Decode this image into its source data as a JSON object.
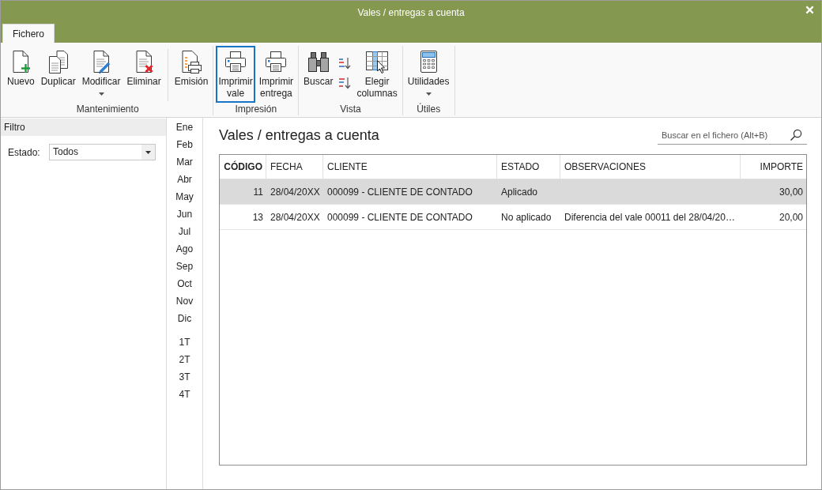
{
  "window": {
    "title": "Vales / entregas a cuenta"
  },
  "ribbon": {
    "tabs": [
      {
        "label": "Fichero",
        "selected": true
      }
    ],
    "groups": [
      {
        "label": "Mantenimiento",
        "items": [
          {
            "kind": "large",
            "label": "Nuevo",
            "selected": false,
            "dropdown": false
          },
          {
            "kind": "large",
            "label": "Duplicar",
            "selected": false,
            "dropdown": false
          },
          {
            "kind": "large",
            "label": "Modificar",
            "selected": false,
            "dropdown": true
          },
          {
            "kind": "large",
            "label": "Eliminar",
            "selected": false,
            "dropdown": false
          },
          {
            "kind": "separator"
          },
          {
            "kind": "large",
            "label": "Emisión",
            "selected": false,
            "dropdown": false
          }
        ]
      },
      {
        "label": "Impresión",
        "items": [
          {
            "kind": "large",
            "label": "Imprimir vale",
            "selected": true,
            "dropdown": false
          },
          {
            "kind": "large",
            "label": "Imprimir entrega",
            "selected": false,
            "dropdown": false
          }
        ]
      },
      {
        "label": "Vista",
        "items": [
          {
            "kind": "large",
            "label": "Buscar",
            "selected": false,
            "dropdown": false
          },
          {
            "kind": "small",
            "selected": false
          },
          {
            "kind": "small",
            "selected": false
          },
          {
            "kind": "large",
            "label": "Elegir columnas",
            "selected": false,
            "dropdown": false
          }
        ]
      },
      {
        "label": "Útiles",
        "items": [
          {
            "kind": "large",
            "label": "Utilidades",
            "selected": false,
            "dropdown": true
          }
        ]
      }
    ]
  },
  "filter": {
    "title": "Filtro",
    "fields": [
      {
        "label": "Estado:",
        "value": "Todos"
      }
    ]
  },
  "periods": {
    "months": [
      {
        "label": "Ene",
        "selected": false
      },
      {
        "label": "Feb",
        "selected": false
      },
      {
        "label": "Mar",
        "selected": false
      },
      {
        "label": "Abr",
        "selected": false
      },
      {
        "label": "May",
        "selected": false
      },
      {
        "label": "Jun",
        "selected": false
      },
      {
        "label": "Jul",
        "selected": false
      },
      {
        "label": "Ago",
        "selected": false
      },
      {
        "label": "Sep",
        "selected": false
      },
      {
        "label": "Oct",
        "selected": false
      },
      {
        "label": "Nov",
        "selected": false
      },
      {
        "label": "Dic",
        "selected": false
      }
    ],
    "quarters": [
      {
        "label": "1T",
        "selected": false
      },
      {
        "label": "2T",
        "selected": false
      },
      {
        "label": "3T",
        "selected": false
      },
      {
        "label": "4T",
        "selected": false
      }
    ]
  },
  "main": {
    "title": "Vales / entregas a cuenta",
    "search": {
      "placeholder": "Buscar en el fichero (Alt+B)"
    },
    "table": {
      "columns": [
        {
          "label": "CÓDIGO",
          "kind": "number",
          "sorted": true
        },
        {
          "label": "FECHA",
          "kind": "text",
          "sorted": false
        },
        {
          "label": "CLIENTE",
          "kind": "text",
          "sorted": false
        },
        {
          "label": "ESTADO",
          "kind": "text",
          "sorted": false
        },
        {
          "label": "OBSERVACIONES",
          "kind": "text",
          "sorted": false
        },
        {
          "label": "IMPORTE",
          "kind": "number",
          "sorted": false
        }
      ],
      "rows": [
        {
          "selected": true,
          "codigo": "11",
          "fecha": "28/04/20XX",
          "cliente": "000099 - CLIENTE DE CONTADO",
          "estado": "Aplicado",
          "importe": "30,00"
        },
        {
          "selected": false,
          "codigo": "13",
          "fecha": "28/04/20XX",
          "cliente": "000099 - CLIENTE DE CONTADO",
          "estado": "No aplicado",
          "observaciones": "Diferencia del vale 00011 del 28/04/20…",
          "importe": "20,00"
        }
      ]
    }
  }
}
